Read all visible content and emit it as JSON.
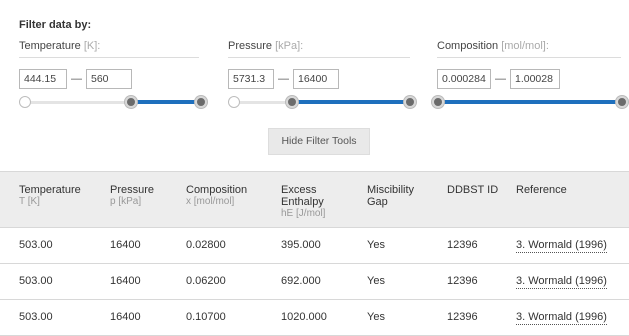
{
  "filter": {
    "title": "Filter data by:",
    "groups": [
      {
        "name": "Temperature",
        "unit": "[K]:",
        "min": "444.15",
        "max": "560",
        "range_fraction": [
          0.0,
          1.0
        ],
        "selected_fraction": [
          0.6,
          1.0
        ]
      },
      {
        "name": "Pressure",
        "unit": "[kPa]:",
        "min": "5731.3",
        "max": "16400",
        "range_fraction": [
          0.0,
          1.0
        ],
        "selected_fraction": [
          0.33,
          1.0
        ]
      },
      {
        "name": "Composition",
        "unit": "[mol/mol]:",
        "min": "0.000284",
        "max": "1.00028",
        "range_fraction": [
          0.0,
          1.0
        ],
        "selected_fraction": [
          0.0,
          1.0
        ]
      }
    ],
    "dash": "—",
    "hide_button": "Hide Filter Tools",
    "dots": "...."
  },
  "table": {
    "headers": [
      {
        "title": "Temperature",
        "sub": "T [K]"
      },
      {
        "title": "Pressure",
        "sub": "p [kPa]"
      },
      {
        "title": "Composition",
        "sub": "x [mol/mol]"
      },
      {
        "title": "Excess Enthalpy",
        "sub": "hE [J/mol]"
      },
      {
        "title": "Miscibility Gap",
        "sub": ""
      },
      {
        "title": "DDBST ID",
        "sub": ""
      },
      {
        "title": "Reference",
        "sub": ""
      }
    ],
    "rows": [
      [
        "503.00",
        "16400",
        "0.02800",
        "395.000",
        "Yes",
        "12396",
        "3. Wormald (1996)"
      ],
      [
        "503.00",
        "16400",
        "0.06200",
        "692.000",
        "Yes",
        "12396",
        "3. Wormald (1996)"
      ],
      [
        "503.00",
        "16400",
        "0.10700",
        "1020.000",
        "Yes",
        "12396",
        "3. Wormald (1996)"
      ]
    ]
  },
  "colors": {
    "slider_fill": "#1e6fbd",
    "header_bg": "#ededed",
    "button_bg": "#e9e9e9"
  }
}
